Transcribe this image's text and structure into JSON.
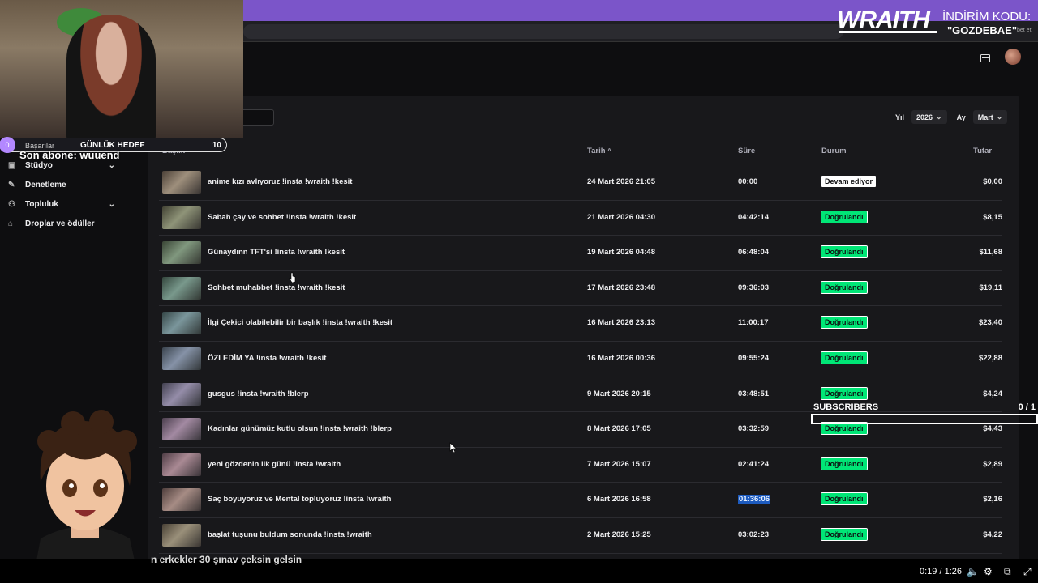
{
  "overlay": {
    "brand": "WRAITH",
    "promo_title": "İNDİRİM KODU:",
    "promo_code": "\"GOZDEBAE\"",
    "promo_small": "bet et",
    "goal_count": "0",
    "goal_prev": "Başarılar",
    "goal_label": "GÜNLÜK HEDEF",
    "goal_target": "10",
    "last_sub": "Son abone: wuuend",
    "subscribers_label": "SUBSCRIBERS",
    "subscribers_count": "0 / 1",
    "ticker": "n erkekler 30 şınav çeksin gelsin"
  },
  "player": {
    "time": "0:19 / 1:26"
  },
  "sidebar": {
    "items": [
      {
        "label": "Stüdyo",
        "icon": "studio-icon",
        "chevron": true
      },
      {
        "label": "Denetleme",
        "icon": "wrench-icon",
        "chevron": false
      },
      {
        "label": "Topluluk",
        "icon": "community-icon",
        "chevron": true
      },
      {
        "label": "Droplar ve ödüller",
        "icon": "gift-icon",
        "chevron": false
      }
    ]
  },
  "filters": {
    "year_label": "Yıl",
    "year_value": "2026",
    "month_label": "Ay",
    "month_value": "Mart"
  },
  "table": {
    "headers": {
      "title": "Başlık",
      "date": "Tarih",
      "duration": "Süre",
      "status": "Durum",
      "amount": "Tutar"
    },
    "rows": [
      {
        "title": "anime kızı avlıyoruz !insta !wraith !kesit",
        "date": "24 Mart 2026 21:05",
        "duration": "00:00",
        "status": "Devam ediyor",
        "amount": "$0,00"
      },
      {
        "title": "Sabah çay ve sohbet !insta !wraith !kesit",
        "date": "21 Mart 2026 04:30",
        "duration": "04:42:14",
        "status": "Doğrulandı",
        "amount": "$8,15"
      },
      {
        "title": "Günaydınn TFT'si !insta !wraith !kesit",
        "date": "19 Mart 2026 04:48",
        "duration": "06:48:04",
        "status": "Doğrulandı",
        "amount": "$11,68"
      },
      {
        "title": "Sohbet muhabbet !insta !wraith !kesit",
        "date": "17 Mart 2026 23:48",
        "duration": "09:36:03",
        "status": "Doğrulandı",
        "amount": "$19,11"
      },
      {
        "title": "İlgi Çekici olabilebilir bir başlık !insta !wraith !kesit",
        "date": "16 Mart 2026 23:13",
        "duration": "11:00:17",
        "status": "Doğrulandı",
        "amount": "$23,40"
      },
      {
        "title": "ÖZLEDİM YA !insta !wraith !kesit",
        "date": "16 Mart 2026 00:36",
        "duration": "09:55:24",
        "status": "Doğrulandı",
        "amount": "$22,88"
      },
      {
        "title": "gusgus !insta !wraith !blerp",
        "date": "9 Mart 2026 20:15",
        "duration": "03:48:51",
        "status": "Doğrulandı",
        "amount": "$4,24"
      },
      {
        "title": "Kadınlar günümüz kutlu olsun !insta !wraith !blerp",
        "date": "8 Mart 2026 17:05",
        "duration": "03:32:59",
        "status": "Doğrulandı",
        "amount": "$4,43"
      },
      {
        "title": "yeni gözdenin ilk günü !insta !wraith",
        "date": "7 Mart 2026 15:07",
        "duration": "02:41:24",
        "status": "Doğrulandı",
        "amount": "$2,89"
      },
      {
        "title": "Saç boyuyoruz ve Mental topluyoruz !insta !wraith",
        "date": "6 Mart 2026 16:58",
        "duration": "01:36:06",
        "status": "Doğrulandı",
        "amount": "$2,16"
      },
      {
        "title": "başlat tuşunu buldum sonunda !insta !wraith",
        "date": "2 Mart 2026 15:25",
        "duration": "03:02:23",
        "status": "Doğrulandı",
        "amount": "$4,22"
      }
    ]
  },
  "colors": {
    "accent_purple": "#7b55c9",
    "status_green": "#00e676",
    "panel_bg": "#18181b",
    "page_bg": "#0e0e10"
  }
}
